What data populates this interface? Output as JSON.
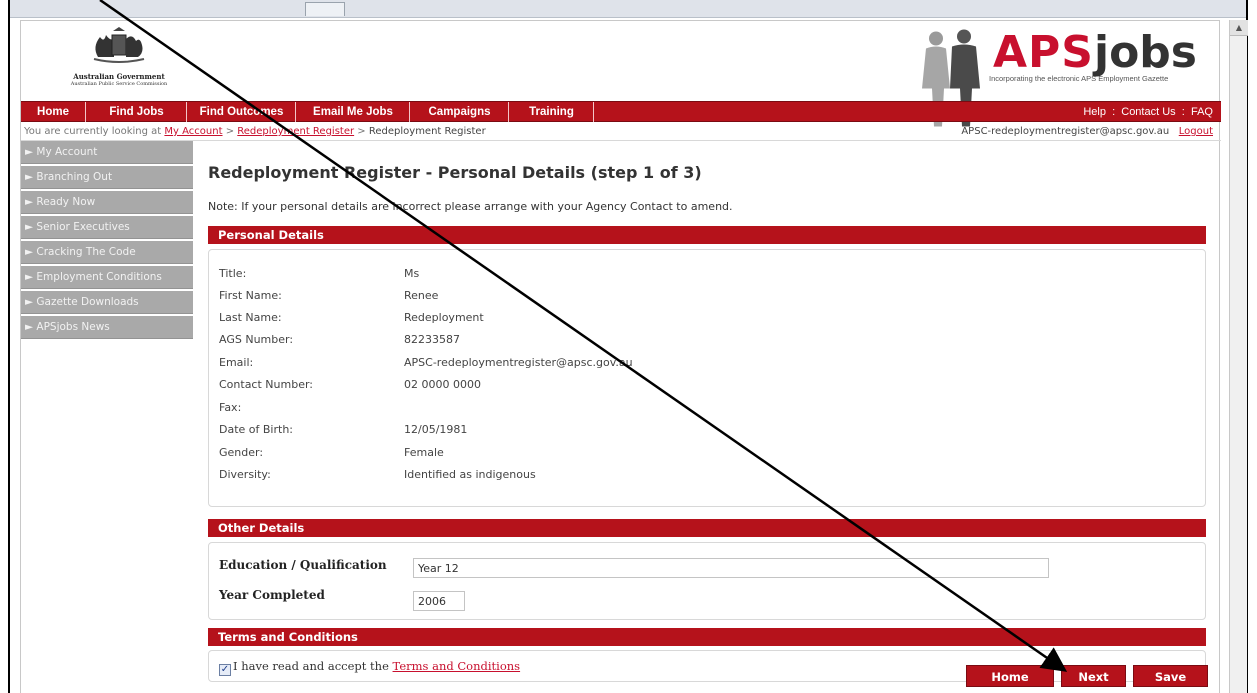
{
  "header": {
    "gov_name": "Australian Government",
    "commission": "Australian Public Service Commission",
    "logo_aps": "APS",
    "logo_jobs": "jobs",
    "tagline": "Incorporating the electronic APS Employment Gazette"
  },
  "nav": {
    "items": [
      "Home",
      "Find Jobs",
      "Find Outcomes",
      "Email Me Jobs",
      "Campaigns",
      "Training"
    ],
    "help": "Help",
    "contact": "Contact Us",
    "faq": "FAQ",
    "sep": ":"
  },
  "breadcrumb": {
    "prefix": "You are currently looking at",
    "link1": "My Account",
    "sep": ">",
    "link2": "Redeployment Register",
    "current": "Redeployment Register",
    "email": "APSC-redeploymentregister@apsc.gov.au",
    "logout": "Logout"
  },
  "sidebar": {
    "items": [
      "► My Account",
      "► Branching Out",
      "► Ready Now",
      "► Senior Executives",
      "► Cracking The Code",
      "► Employment Conditions",
      "► Gazette Downloads",
      "► APSjobs News"
    ]
  },
  "main": {
    "title": "Redeployment Register - Personal Details (step 1 of 3)",
    "note": "Note: If your personal details are incorrect please arrange with your Agency Contact to amend."
  },
  "personal": {
    "heading": "Personal Details",
    "rows": [
      {
        "label": "Title:",
        "value": "Ms"
      },
      {
        "label": "First Name:",
        "value": "Renee"
      },
      {
        "label": "Last Name:",
        "value": "Redeployment"
      },
      {
        "label": "AGS Number:",
        "value": "82233587"
      },
      {
        "label": "Email:",
        "value": "APSC-redeploymentregister@apsc.gov.au"
      },
      {
        "label": "Contact Number:",
        "value": "02 0000 0000"
      },
      {
        "label": "Fax:",
        "value": ""
      },
      {
        "label": "Date of Birth:",
        "value": "12/05/1981"
      },
      {
        "label": "Gender:",
        "value": "Female"
      },
      {
        "label": "Diversity:",
        "value": "Identified as indigenous"
      }
    ]
  },
  "other": {
    "heading": "Other Details",
    "education_label": "Education / Qualification",
    "education_value": "Year 12",
    "year_label": "Year Completed",
    "year_value": "2006"
  },
  "terms": {
    "heading": "Terms and Conditions",
    "checked": true,
    "check_mark": "✓",
    "text": "I have read and accept the",
    "link": "Terms and Conditions"
  },
  "buttons": {
    "home": "Home",
    "next": "Next",
    "save": "Save"
  },
  "colors": {
    "brand_red": "#b5121b",
    "sidebar_gray": "#a9a9a9",
    "link_red": "#c8102e"
  }
}
